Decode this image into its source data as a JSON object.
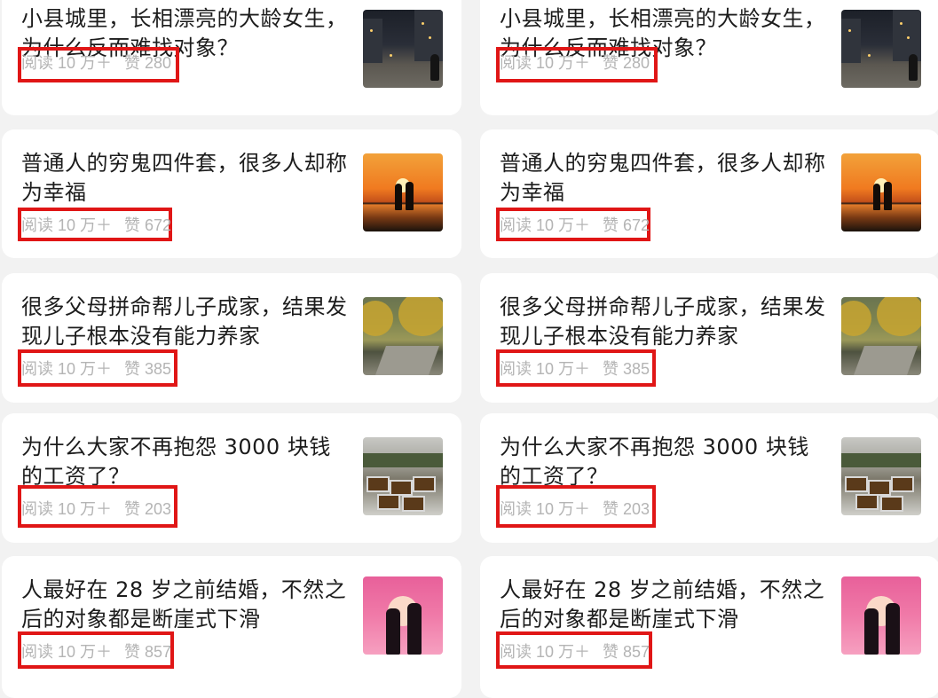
{
  "articles_left": [
    {
      "title": "小县城里，长相漂亮的大龄女生，为什么反而难找对象？",
      "reads": "阅读 10 万＋",
      "likes": "赞 280",
      "thumb_icon": "night-street-photo"
    },
    {
      "title": "普通人的穷鬼四件套，很多人却称为幸福",
      "reads": "阅读 10 万＋",
      "likes": "赞 672",
      "thumb_icon": "sunset-couple-photo"
    },
    {
      "title": "很多父母拼命帮儿子成家，结果发现儿子根本没有能力养家",
      "reads": "阅读 10 万＋",
      "likes": "赞 385",
      "thumb_icon": "tree-street-photo"
    },
    {
      "title": "为什么大家不再抱怨 3000 块钱的工资了？",
      "reads": "阅读 10 万＋",
      "likes": "赞 203",
      "thumb_icon": "food-stall-photo"
    },
    {
      "title": "人最好在 28 岁之前结婚，不然之后的对象都是断崖式下滑",
      "reads": "阅读 10 万＋",
      "likes": "赞 857",
      "thumb_icon": "pink-couple-illustration"
    }
  ],
  "articles_right": [
    {
      "title": "小县城里，长相漂亮的大龄女生，为什么反而难找对象？",
      "reads": "阅读 10 万＋",
      "likes": "赞 280",
      "thumb_icon": "night-street-photo"
    },
    {
      "title": "普通人的穷鬼四件套，很多人却称为幸福",
      "reads": "阅读 10 万＋",
      "likes": "赞 672",
      "thumb_icon": "sunset-couple-photo"
    },
    {
      "title": "很多父母拼命帮儿子成家，结果发现儿子根本没有能力养家",
      "reads": "阅读 10 万＋",
      "likes": "赞 385",
      "thumb_icon": "tree-street-photo"
    },
    {
      "title": "为什么大家不再抱怨 3000 块钱的工资了？",
      "reads": "阅读 10 万＋",
      "likes": "赞 203",
      "thumb_icon": "food-stall-photo"
    },
    {
      "title": "人最好在 28 岁之前结婚，不然之后的对象都是断崖式下滑",
      "reads": "阅读 10 万＋",
      "likes": "赞 857",
      "thumb_icon": "pink-couple-illustration"
    }
  ],
  "colors": {
    "page_bg": "#f2f2f2",
    "card_bg": "#ffffff",
    "title_text": "#1c1c1c",
    "meta_text": "#b4b4b4",
    "highlight_border": "#e01616"
  }
}
